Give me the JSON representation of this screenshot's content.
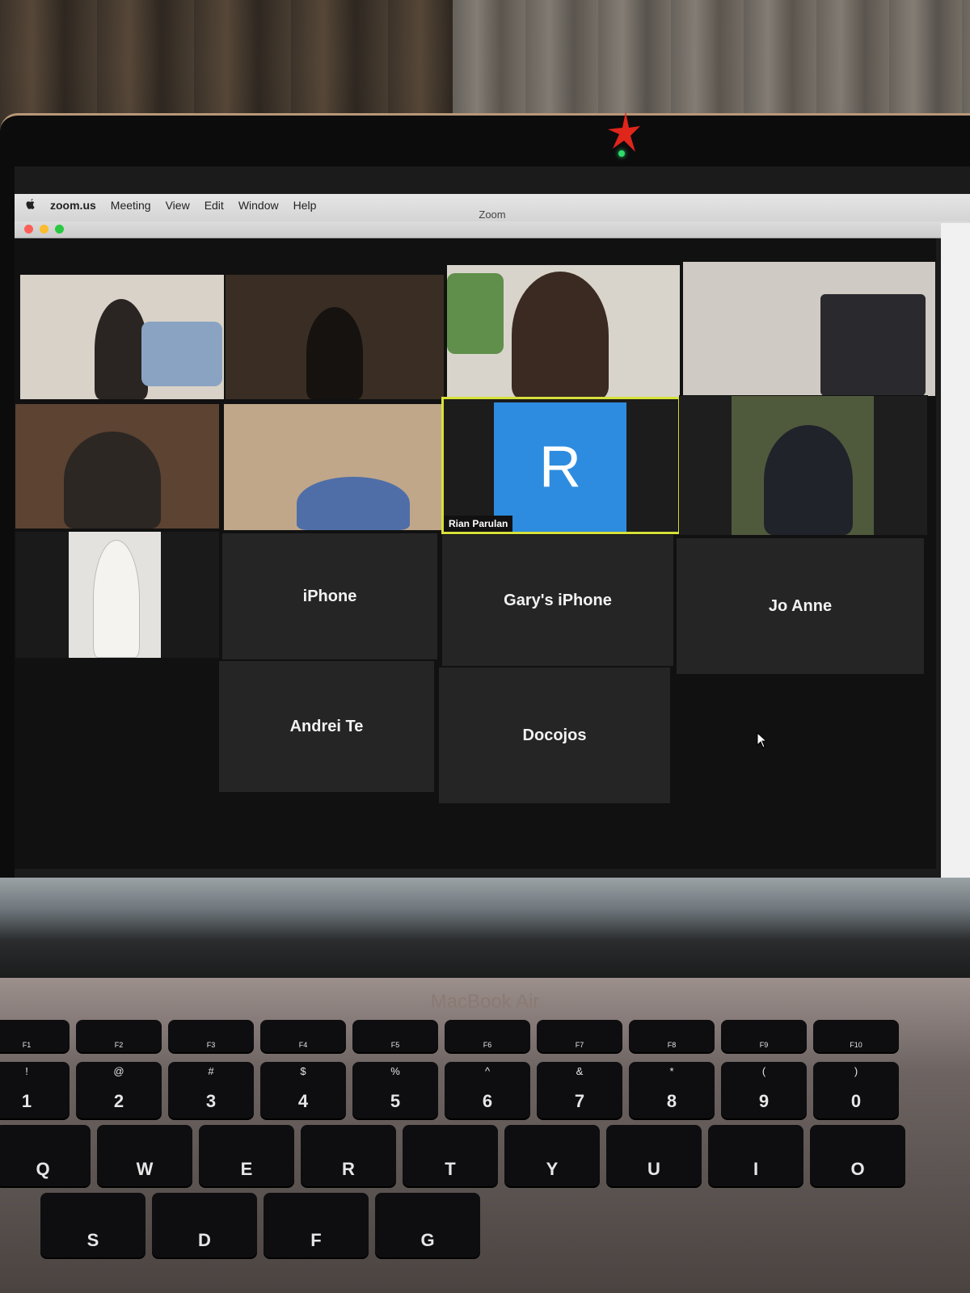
{
  "menubar": {
    "app": "zoom.us",
    "items": [
      "Meeting",
      "View",
      "Edit",
      "Window",
      "Help"
    ]
  },
  "window": {
    "title": "Zoom"
  },
  "participants": {
    "active_speaker_initial": "R",
    "active_speaker_name": "Rian Parulan",
    "name_tiles": [
      "iPhone",
      "Gary's iPhone",
      "Jo Anne",
      "Andrei Te",
      "Docojos"
    ]
  },
  "laptop": {
    "brand": "MacBook Air"
  },
  "keyboard": {
    "fn_row": [
      {
        "fn": "F1"
      },
      {
        "fn": "F2"
      },
      {
        "fn": "F3"
      },
      {
        "fn": "F4"
      },
      {
        "fn": "F5"
      },
      {
        "fn": "F6"
      },
      {
        "fn": "F7"
      },
      {
        "fn": "F8"
      },
      {
        "fn": "F9"
      },
      {
        "fn": "F10"
      }
    ],
    "num_row": [
      {
        "top": "!",
        "main": "1"
      },
      {
        "top": "@",
        "main": "2"
      },
      {
        "top": "#",
        "main": "3"
      },
      {
        "top": "$",
        "main": "4"
      },
      {
        "top": "%",
        "main": "5"
      },
      {
        "top": "^",
        "main": "6"
      },
      {
        "top": "&",
        "main": "7"
      },
      {
        "top": "*",
        "main": "8"
      },
      {
        "top": "(",
        "main": "9"
      },
      {
        "top": ")",
        "main": "0"
      }
    ],
    "q_row": [
      "Q",
      "W",
      "E",
      "R",
      "T",
      "Y",
      "U",
      "I",
      "O"
    ],
    "a_row": [
      "S",
      "D",
      "F",
      "G"
    ]
  }
}
